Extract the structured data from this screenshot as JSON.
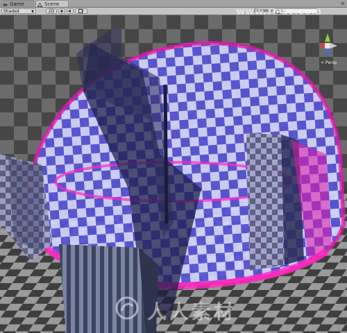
{
  "tabs": [
    {
      "label": "Game",
      "icon": "game-controller-icon",
      "active": false
    },
    {
      "label": "Scene",
      "icon": "scene-icon",
      "active": true
    }
  ],
  "window_controls": "≡",
  "toolbar": {
    "shading_mode": "Shaded",
    "toggle_2d": "2D",
    "lighting_icon": "sun-icon",
    "audio_icon": "speaker-icon",
    "effects_icon": "image-effects-icon",
    "gizmos_label": "Gizmos ▾",
    "search_placeholder": "All"
  },
  "scene_gizmo": {
    "projection_label": "< Persp",
    "axis_colors": {
      "x": "#e23a3a",
      "y": "#8fd13a",
      "z": "#3a6fe2"
    }
  },
  "watermark": {
    "url": "www.rr-sc.com",
    "text": "人人素材"
  },
  "colors": {
    "dome_blue": "#5a55e6",
    "dome_rim_magenta": "#e01aa8",
    "floor_dark": "#474747",
    "floor_light": "#8c8c8c"
  }
}
